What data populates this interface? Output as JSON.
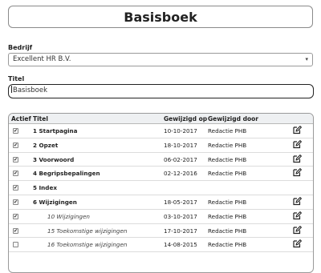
{
  "page": {
    "title": "Basisboek"
  },
  "form": {
    "company_label": "Bedrijf",
    "company_value": "Excellent HR B.V.",
    "title_label": "Titel",
    "title_value": "Basisboek"
  },
  "table": {
    "headers": {
      "active": "Actief",
      "title": "Titel",
      "modified_on": "Gewijzigd op",
      "modified_by": "Gewijzigd door"
    },
    "rows": [
      {
        "checked": true,
        "title": "1 Startpagina",
        "style": "bold",
        "date": "10-10-2017",
        "by": "Redactie PHB",
        "editable": true
      },
      {
        "checked": true,
        "title": "2 Opzet",
        "style": "bold",
        "date": "18-10-2017",
        "by": "Redactie PHB",
        "editable": true
      },
      {
        "checked": true,
        "title": "3 Voorwoord",
        "style": "bold",
        "date": "06-02-2017",
        "by": "Redactie PHB",
        "editable": true
      },
      {
        "checked": true,
        "title": "4 Begripsbepalingen",
        "style": "bold",
        "date": "02-12-2016",
        "by": "Redactie PHB",
        "editable": true
      },
      {
        "checked": true,
        "title": "5 Index",
        "style": "bold",
        "date": "",
        "by": "",
        "editable": false
      },
      {
        "checked": true,
        "title": "6 Wijzigingen",
        "style": "bold",
        "date": "18-05-2017",
        "by": "Redactie PHB",
        "editable": true
      },
      {
        "checked": true,
        "title": "10 Wijzigingen",
        "style": "sub",
        "date": "03-10-2017",
        "by": "Redactie PHB",
        "editable": true
      },
      {
        "checked": true,
        "title": "15 Toekomstige wijzigingen",
        "style": "sub",
        "date": "17-10-2017",
        "by": "Redactie PHB",
        "editable": true
      },
      {
        "checked": false,
        "title": "16 Toekomstige wijzigingen",
        "style": "sub",
        "date": "14-08-2015",
        "by": "Redactie PHB",
        "editable": true
      }
    ]
  }
}
